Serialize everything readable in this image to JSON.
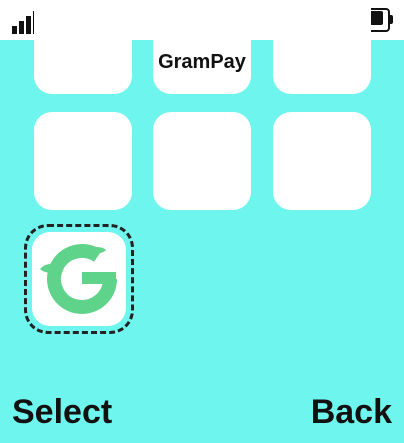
{
  "app": {
    "title": "GramPay"
  },
  "status_bar": {
    "signal_icon": "signal-strength-icon",
    "battery_icon": "battery-full-icon"
  },
  "grid": {
    "selected_app_icon": "grampay-logo-icon",
    "brand_color": "#5fd38a"
  },
  "softkeys": {
    "left_label": "Select",
    "right_label": "Back"
  },
  "colors": {
    "background": "#6ef5ee",
    "tile": "#ffffff"
  }
}
